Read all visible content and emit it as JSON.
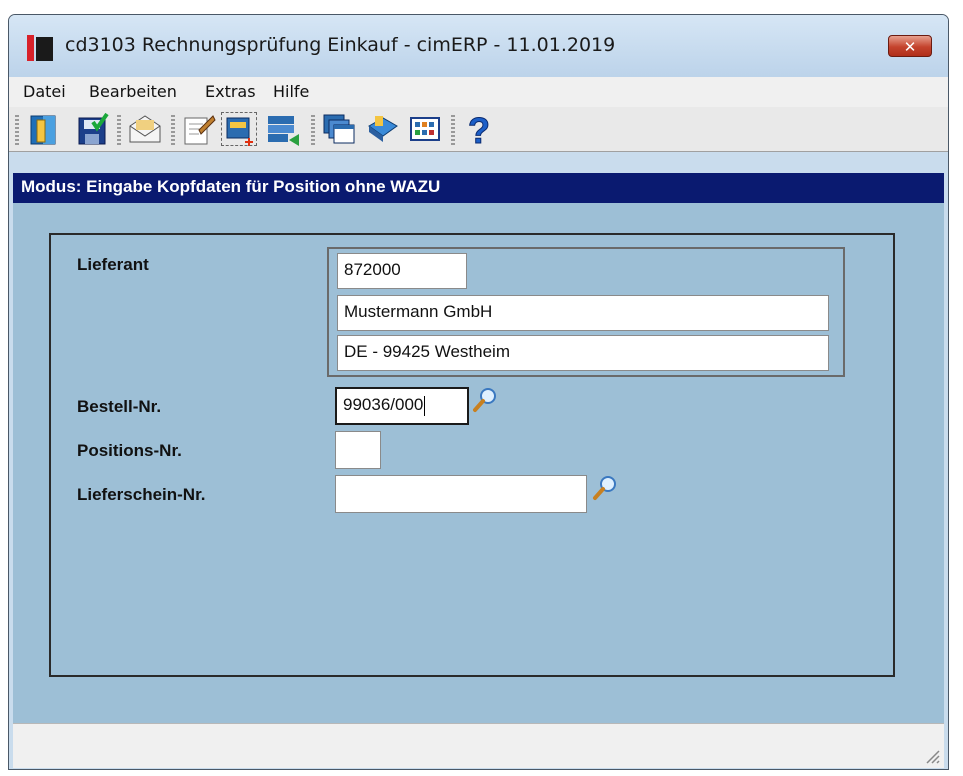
{
  "window": {
    "title": "cd3103 Rechnungsprüfung Einkauf - cimERP - 11.01.2019",
    "close_label": "✕"
  },
  "menu": [
    "Datei",
    "Bearbeiten",
    "Extras",
    "Hilfe"
  ],
  "toolbar": {
    "buttons": [
      "exit-door-icon",
      "save-icon",
      "mail-icon",
      "edit-document-icon",
      "new-record-icon",
      "import-list-icon",
      "windows-icon",
      "book-icon",
      "grid-view-icon",
      "help-icon"
    ]
  },
  "mode_text": "Modus: Eingabe Kopfdaten für Position ohne WAZU",
  "form": {
    "supplier_label": "Lieferant",
    "supplier_number": "872000",
    "supplier_name": "Mustermann GmbH",
    "supplier_address": "DE - 99425 Westheim",
    "order_label": "Bestell-Nr.",
    "order_value": "99036/000",
    "position_label": "Positions-Nr.",
    "position_value": "",
    "delivery_label": "Lieferschein-Nr.",
    "delivery_value": ""
  },
  "status": {
    "text": ""
  },
  "colors": {
    "mode_bar": "#0a1a70",
    "content_bg": "#9dbfd6"
  }
}
